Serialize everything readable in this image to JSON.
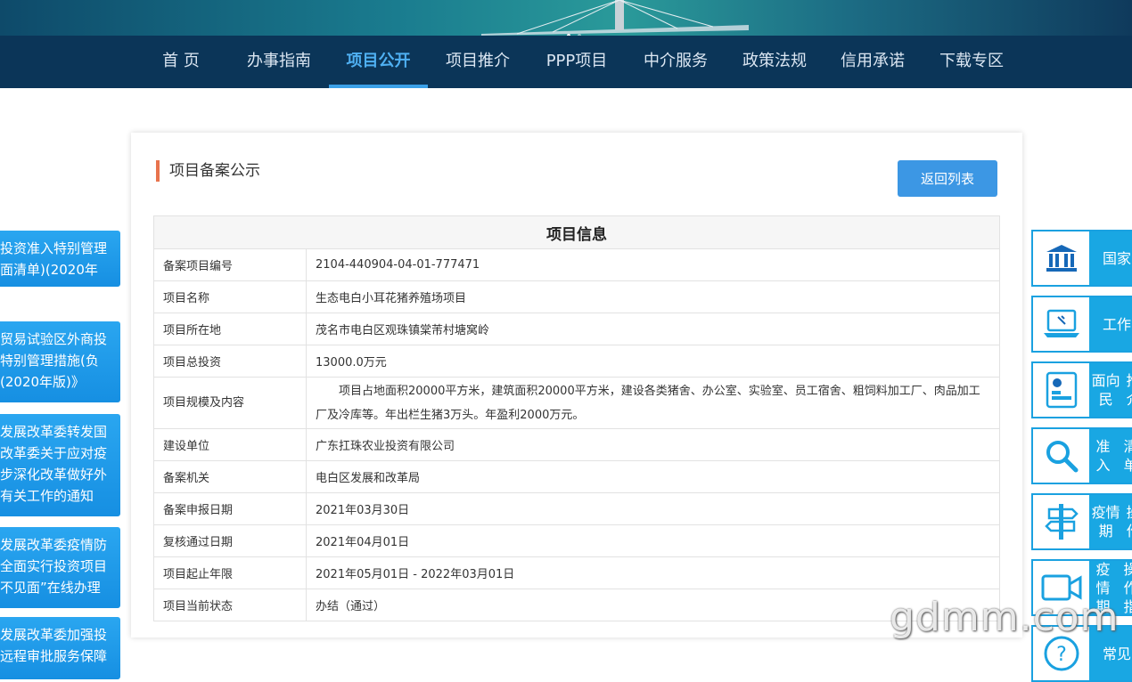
{
  "nav": {
    "items": [
      "首 页",
      "办事指南",
      "项目公开",
      "项目推介",
      "PPP项目",
      "中介服务",
      "政策法规",
      "信用承诺",
      "下载专区"
    ],
    "active_index": 2
  },
  "section": {
    "title": "项目备案公示",
    "back_button": "返回列表"
  },
  "table": {
    "header": "项目信息",
    "rows": [
      {
        "label": "备案项目编号",
        "value": "2104-440904-04-01-777471"
      },
      {
        "label": "项目名称",
        "value": "生态电白小耳花猪养殖场项目"
      },
      {
        "label": "项目所在地",
        "value": "茂名市电白区观珠镇棠芾村塘窝岭"
      },
      {
        "label": "项目总投资",
        "value": "13000.0万元"
      },
      {
        "label": "项目规模及内容",
        "value": "项目占地面积20000平方米，建筑面积20000平方米，建设各类猪舍、办公室、实验室、员工宿舍、粗饲料加工厂、肉品加工厂及冷库等。年出栏生猪3万头。年盈利2000万元。"
      },
      {
        "label": "建设单位",
        "value": "广东扛珠农业投资有限公司"
      },
      {
        "label": "备案机关",
        "value": "电白区发展和改革局"
      },
      {
        "label": "备案申报日期",
        "value": "2021年03月30日"
      },
      {
        "label": "复核通过日期",
        "value": "2021年04月01日"
      },
      {
        "label": "项目起止年限",
        "value": "2021年05月01日 - 2022年03月01日"
      },
      {
        "label": "项目当前状态",
        "value": "办结（通过）"
      }
    ]
  },
  "left_banners": [
    [
      "投资准入特别管理",
      "面清单)(2020年"
    ],
    [
      "贸易试验区外商投",
      "特别管理措施(负",
      "(2020年版)》"
    ],
    [
      "发展改革委转发国",
      "改革委关于应对疫",
      "步深化改革做好外",
      "有关工作的通知"
    ],
    [
      "发展改革委疫情防",
      "全面实行投资项目",
      "不见面”在线办理"
    ],
    [
      "发展改革委加强投",
      "远程审批服务保障"
    ]
  ],
  "side_items": [
    {
      "icon": "bank-building-icon",
      "label": [
        "国家"
      ]
    },
    {
      "icon": "laptop-icon",
      "label": [
        "工作"
      ]
    },
    {
      "icon": "document-chart-icon",
      "label": [
        "面向民",
        "推介"
      ]
    },
    {
      "icon": "magnifier-icon",
      "label": [
        "准入",
        "清单"
      ]
    },
    {
      "icon": "signpost-icon",
      "label": [
        "疫情期",
        "操作"
      ]
    },
    {
      "icon": "video-camera-icon",
      "label": [
        "疫情期",
        "操作指"
      ]
    },
    {
      "icon": "question-icon",
      "label": [
        "常见"
      ]
    }
  ],
  "watermark": "gdmm.com",
  "colors": {
    "nav_bg": "#0b3558",
    "accent": "#3c97e4",
    "side": "#19a7e3",
    "title_bar": "#e8734d"
  }
}
